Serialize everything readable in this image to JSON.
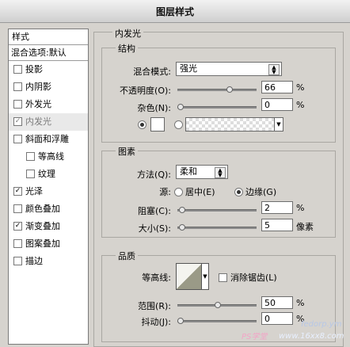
{
  "window": {
    "title": "图层样式"
  },
  "sidebar": {
    "header": "样式",
    "blend": "混合选项:默认",
    "items": [
      {
        "label": "投影",
        "checked": false
      },
      {
        "label": "内阴影",
        "checked": false
      },
      {
        "label": "外发光",
        "checked": false
      },
      {
        "label": "内发光",
        "checked": true,
        "active": true
      },
      {
        "label": "斜面和浮雕",
        "checked": false
      },
      {
        "label": "等高线",
        "checked": false,
        "sub": true
      },
      {
        "label": "纹理",
        "checked": false,
        "sub": true
      },
      {
        "label": "光泽",
        "checked": true
      },
      {
        "label": "颜色叠加",
        "checked": false
      },
      {
        "label": "渐变叠加",
        "checked": true
      },
      {
        "label": "图案叠加",
        "checked": false
      },
      {
        "label": "描边",
        "checked": false
      }
    ]
  },
  "panel": {
    "title": "内发光",
    "structure": {
      "legend": "结构",
      "blend_mode_label": "混合模式:",
      "blend_mode_value": "强光",
      "opacity_label": "不透明度(O):",
      "opacity_value": "66",
      "opacity_unit": "%",
      "opacity_level": 0.66,
      "noise_label": "杂色(N):",
      "noise_value": "0",
      "noise_unit": "%",
      "noise_level": 0
    },
    "elements": {
      "legend": "图素",
      "method_label": "方法(Q):",
      "method_value": "柔和",
      "source_label": "源:",
      "source_center": "居中(E)",
      "source_edge": "边缘(G)",
      "choke_label": "阻塞(C):",
      "choke_value": "2",
      "choke_unit": "%",
      "choke_level": 0.02,
      "size_label": "大小(S):",
      "size_value": "5",
      "size_unit": "像素",
      "size_level": 0.02
    },
    "quality": {
      "legend": "品质",
      "contour_label": "等高线:",
      "antialias_label": "消除锯齿(L)",
      "range_label": "范围(R):",
      "range_value": "50",
      "range_unit": "%",
      "range_level": 0.5,
      "jitter_label": "抖动(J):",
      "jitter_value": "0",
      "jitter_unit": "%",
      "jitter_level": 0
    }
  },
  "watermark": {
    "text1": "PS学堂",
    "text2": "www.16xx8.com",
    "text3": "fedorp.ym"
  },
  "colors": {
    "dialog_bg": "#d6d3ce",
    "sidebar_bg": "#ffffff",
    "active_item": "#e9e9e9"
  }
}
